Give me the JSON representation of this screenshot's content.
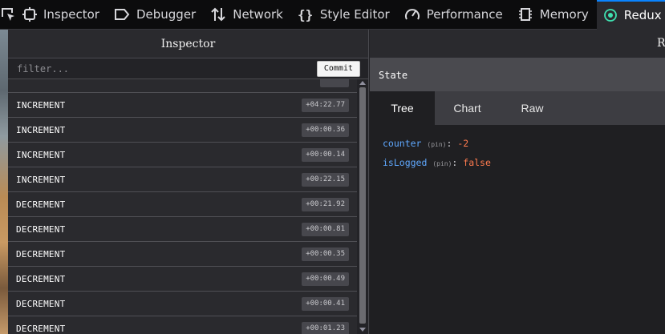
{
  "toolbar": {
    "tabs": [
      {
        "label": "Inspector",
        "icon": "inspector-icon"
      },
      {
        "label": "Debugger",
        "icon": "debugger-icon"
      },
      {
        "label": "Network",
        "icon": "network-icon"
      },
      {
        "label": "Style Editor",
        "icon": "style-editor-icon"
      },
      {
        "label": "Performance",
        "icon": "performance-icon"
      },
      {
        "label": "Memory",
        "icon": "memory-icon"
      },
      {
        "label": "Redux",
        "icon": "redux-icon"
      }
    ],
    "active_tab": "Redux",
    "accent_color": "#0a84ff"
  },
  "left_panel": {
    "title": "Inspector",
    "filter_placeholder": "filter...",
    "commit_label": "Commit",
    "actions": [
      {
        "name": "",
        "time": ""
      },
      {
        "name": "INCREMENT",
        "time": "+04:22.77"
      },
      {
        "name": "INCREMENT",
        "time": "+00:00.36"
      },
      {
        "name": "INCREMENT",
        "time": "+00:00.14"
      },
      {
        "name": "INCREMENT",
        "time": "+00:22.15"
      },
      {
        "name": "DECREMENT",
        "time": "+00:21.92"
      },
      {
        "name": "DECREMENT",
        "time": "+00:00.81"
      },
      {
        "name": "DECREMENT",
        "time": "+00:00.35"
      },
      {
        "name": "DECREMENT",
        "time": "+00:00.49"
      },
      {
        "name": "DECREMENT",
        "time": "+00:00.41"
      },
      {
        "name": "DECREMENT",
        "time": "+00:01.23"
      }
    ]
  },
  "right_panel": {
    "cut_label": "Re",
    "section_title": "State",
    "tabs": [
      "Tree",
      "Chart",
      "Raw"
    ],
    "active_tab": "Tree",
    "state": [
      {
        "key": "counter",
        "pin": "(pin)",
        "value": "-2"
      },
      {
        "key": "isLogged",
        "pin": "(pin)",
        "value": "false"
      }
    ]
  }
}
